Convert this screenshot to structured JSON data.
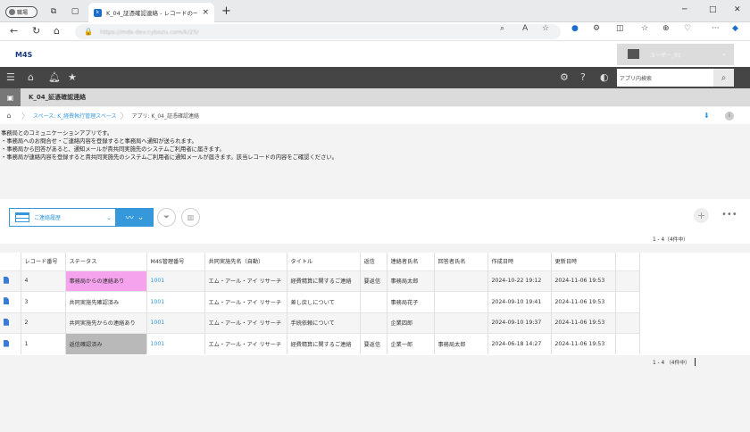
{
  "browser": {
    "profile_label": "職場",
    "tab_title": "K_04_証憑確認連絡 - レコードの一覧",
    "url": "https://mds-dev.cybozu.com/k/25/",
    "win_min": "─",
    "win_max": "□",
    "win_close": "✕"
  },
  "header": {
    "logo": "M4S",
    "user_name": "ユーザー_01",
    "search_placeholder": "アプリ内検索"
  },
  "app": {
    "title": "K_04_証憑確認連絡",
    "breadcrumb": [
      "スペース: K_経費執行管理スペース",
      "アプリ: K_04_証憑確認連絡"
    ]
  },
  "description": [
    "事務局とのコミュニケーションアプリです。",
    "・事務局へのお問合せ・ご連絡内容を登録すると事務局へ通知が送られます。",
    "・事務局から回答があると、通知メールが貴共同実施先のシステムご利用者に届きます。",
    "・事務局が連絡内容を登録すると貴共同実施先のシステムご利用者に通知メールが届きます。該当レコードの内容をご確認ください。"
  ],
  "view": {
    "name": "ご連絡履歴",
    "count_top": "1 - 4（4件中）",
    "count_bottom": "1 - 4 （4件中）"
  },
  "table": {
    "headers": [
      "",
      "レコード番号",
      "ステータス",
      "M4S管理番号",
      "共同実施先名（自動）",
      "タイトル",
      "返信",
      "連絡者氏名",
      "回答者氏名",
      "作成日時",
      "更新日時",
      ""
    ],
    "rows": [
      {
        "no": "4",
        "status": "事務局からの連絡あり",
        "m4s": "1001",
        "partner": "エム・アール・アイ リサーチ",
        "title": "経費精算に関するご連絡",
        "reply": "要返信",
        "contact": "事務局太郎",
        "answer": "",
        "created": "2024-10-22 19:12",
        "updated": "2024-11-06 19:53",
        "status_color": "pink"
      },
      {
        "no": "3",
        "status": "共同実施先確認済み",
        "m4s": "1001",
        "partner": "エム・アール・アイ リサーチ",
        "title": "差し戻しについて",
        "reply": "",
        "contact": "事務局花子",
        "answer": "",
        "created": "2024-09-10 19:41",
        "updated": "2024-11-06 19:53",
        "status_color": ""
      },
      {
        "no": "2",
        "status": "共同実施先からの連絡あり",
        "m4s": "1001",
        "partner": "エム・アール・アイ リサーチ",
        "title": "手続依頼について",
        "reply": "",
        "contact": "企業四郎",
        "answer": "",
        "created": "2024-09-10 19:37",
        "updated": "2024-11-06 19:53",
        "status_color": ""
      },
      {
        "no": "1",
        "status": "返信確認済み",
        "m4s": "1001",
        "partner": "エム・アール・アイ リサーチ",
        "title": "経費精算に関するご連絡",
        "reply": "要返信",
        "contact": "企業一郎",
        "answer": "事務局太郎",
        "created": "2024-06-18 14:27",
        "updated": "2024-11-06 19:53",
        "status_color": "grey"
      }
    ]
  }
}
